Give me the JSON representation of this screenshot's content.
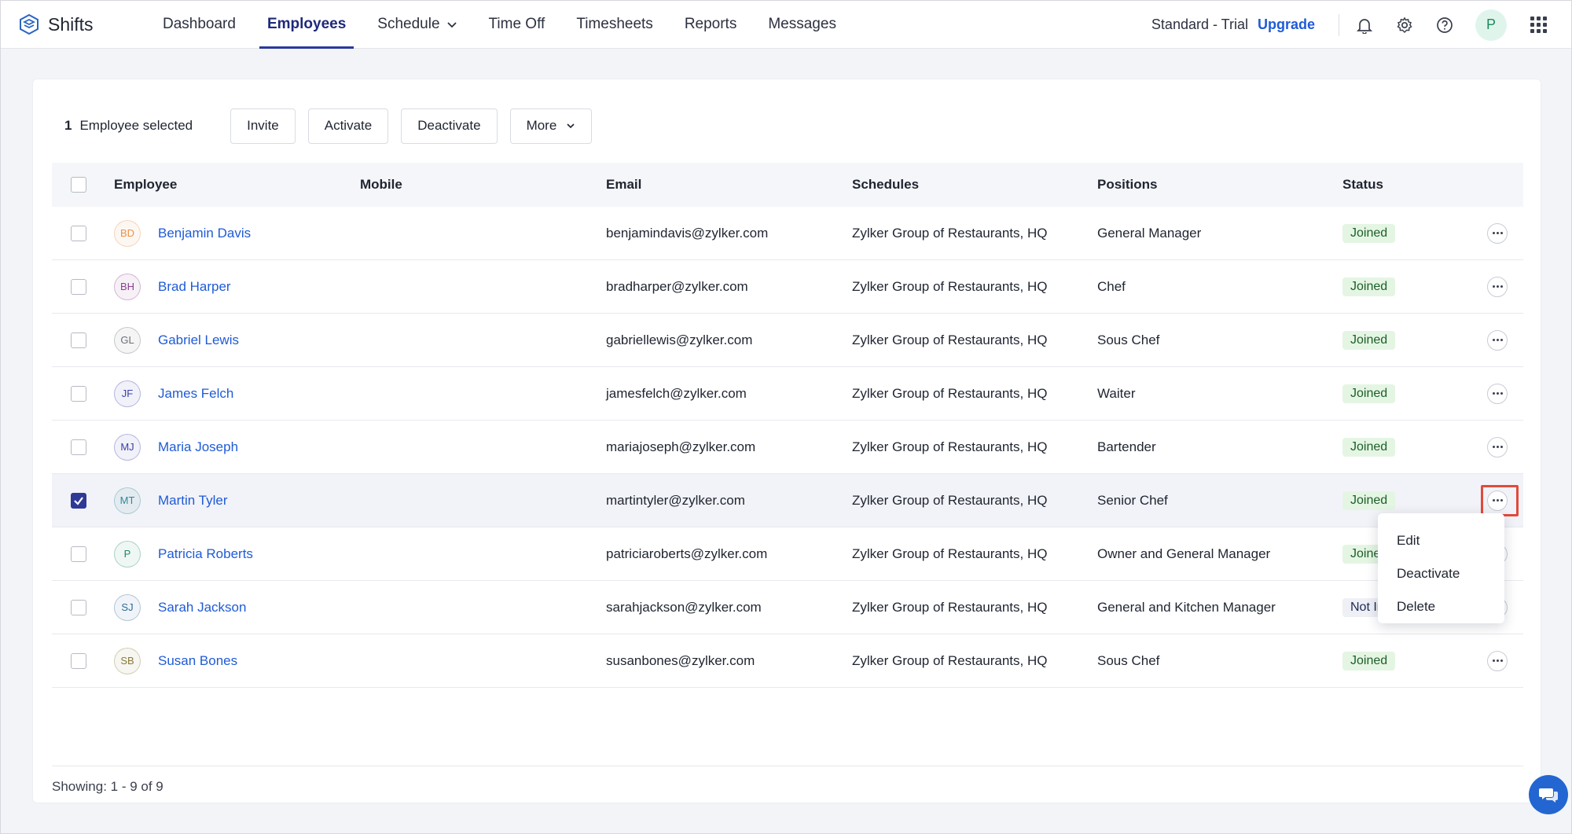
{
  "app": {
    "name": "Shifts"
  },
  "nav": {
    "items": [
      "Dashboard",
      "Employees",
      "Schedule",
      "Time Off",
      "Timesheets",
      "Reports",
      "Messages"
    ],
    "active": "Employees"
  },
  "topright": {
    "plan": "Standard - Trial",
    "upgrade": "Upgrade",
    "avatar_initial": "P",
    "icons": [
      "bell-icon",
      "gear-icon",
      "help-icon",
      "apps-grid-icon"
    ]
  },
  "actionbar": {
    "count": "1",
    "selected_text": "Employee selected",
    "invite": "Invite",
    "activate": "Activate",
    "deactivate": "Deactivate",
    "more": "More"
  },
  "table": {
    "headers": {
      "employee": "Employee",
      "mobile": "Mobile",
      "email": "Email",
      "schedules": "Schedules",
      "positions": "Positions",
      "status": "Status"
    },
    "rows": [
      {
        "initials": "BD",
        "name": "Benjamin Davis",
        "mobile": "",
        "email": "benjamindavis@zylker.com",
        "schedule": "Zylker Group of Restaurants, HQ",
        "position": "General Manager",
        "status": "Joined",
        "avatar_color": "#e8914a",
        "checked": false
      },
      {
        "initials": "BH",
        "name": "Brad Harper",
        "mobile": "",
        "email": "bradharper@zylker.com",
        "schedule": "Zylker Group of Restaurants, HQ",
        "position": "Chef",
        "status": "Joined",
        "avatar_color": "#8a3f8e",
        "checked": false
      },
      {
        "initials": "GL",
        "name": "Gabriel Lewis",
        "mobile": "",
        "email": "gabriellewis@zylker.com",
        "schedule": "Zylker Group of Restaurants, HQ",
        "position": "Sous Chef",
        "status": "Joined",
        "avatar_color": "#6b6f78",
        "checked": false
      },
      {
        "initials": "JF",
        "name": "James Felch",
        "mobile": "",
        "email": "jamesfelch@zylker.com",
        "schedule": "Zylker Group of Restaurants, HQ",
        "position": "Waiter",
        "status": "Joined",
        "avatar_color": "#3b3fa8",
        "checked": false
      },
      {
        "initials": "MJ",
        "name": "Maria Joseph",
        "mobile": "",
        "email": "mariajoseph@zylker.com",
        "schedule": "Zylker Group of Restaurants, HQ",
        "position": "Bartender",
        "status": "Joined",
        "avatar_color": "#3b3fa8",
        "checked": false
      },
      {
        "initials": "MT",
        "name": "Martin Tyler",
        "mobile": "",
        "email": "martintyler@zylker.com",
        "schedule": "Zylker Group of Restaurants, HQ",
        "position": "Senior Chef",
        "status": "Joined",
        "avatar_color": "#2f8a96",
        "checked": true
      },
      {
        "initials": "P",
        "name": "Patricia Roberts",
        "mobile": "",
        "email": "patriciaroberts@zylker.com",
        "schedule": "Zylker Group of Restaurants, HQ",
        "position": "Owner and General Manager",
        "status": "Joined",
        "avatar_color": "#1f8a5f",
        "checked": false
      },
      {
        "initials": "SJ",
        "name": "Sarah Jackson",
        "mobile": "",
        "email": "sarahjackson@zylker.com",
        "schedule": "Zylker Group of Restaurants, HQ",
        "position": "General and Kitchen Manager",
        "status": "Not In",
        "avatar_color": "#2f6a96",
        "checked": false
      },
      {
        "initials": "SB",
        "name": "Susan Bones",
        "mobile": "",
        "email": "susanbones@zylker.com",
        "schedule": "Zylker Group of Restaurants, HQ",
        "position": "Sous Chef",
        "status": "Joined",
        "avatar_color": "#8a7a3a",
        "checked": false
      }
    ]
  },
  "row_menu": {
    "items": [
      "Edit",
      "Deactivate",
      "Delete"
    ]
  },
  "footer": {
    "showing": "Showing: 1 - 9 of 9"
  },
  "colors": {
    "accent": "#2a3a9c",
    "link": "#1f5bd6",
    "highlight": "#e24a3b"
  }
}
